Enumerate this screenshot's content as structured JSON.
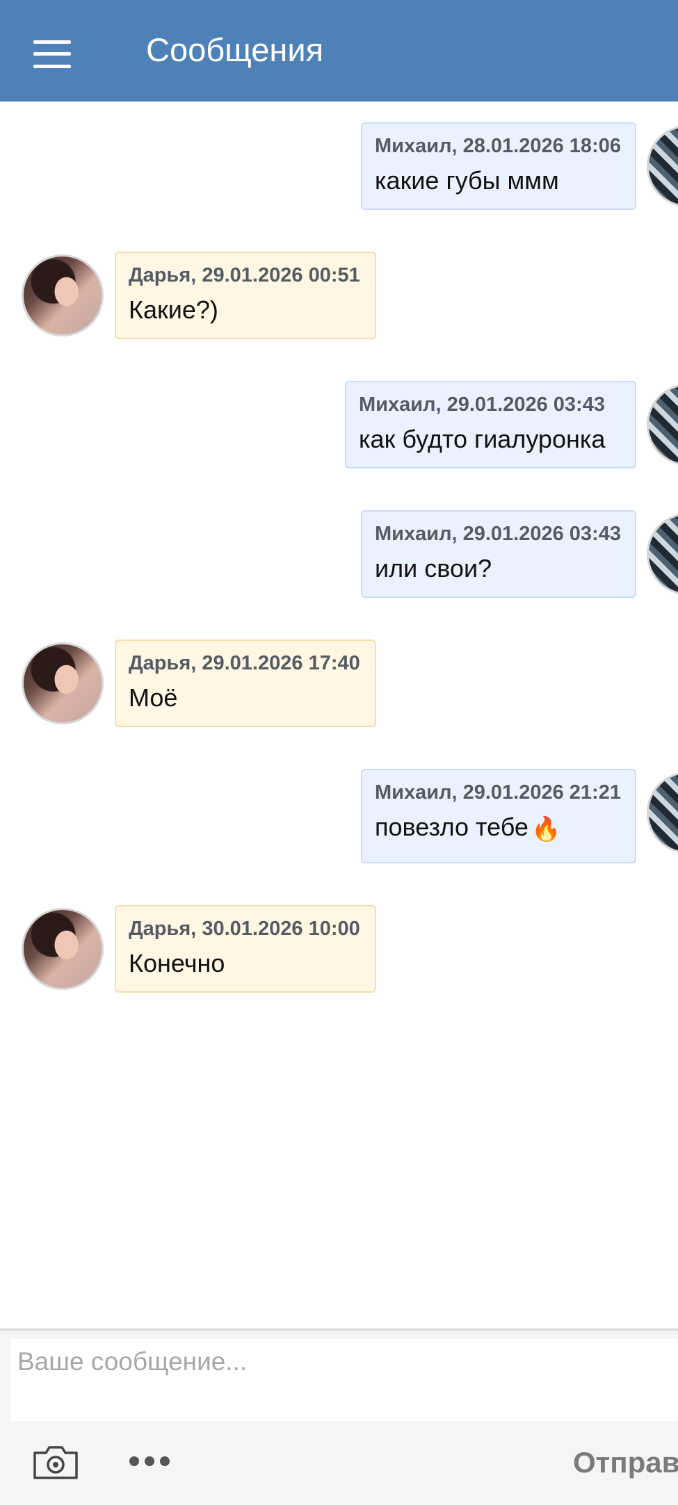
{
  "header": {
    "menu_icon": "hamburger-menu-icon",
    "title": "Сообщения",
    "color": "#4f81b9"
  },
  "messages": [
    {
      "direction": "out",
      "author": "Михаил",
      "datetime": "28.01.2026 18:06",
      "meta": "Михаил, 28.01.2026 18:06",
      "text": "какие губы ммм"
    },
    {
      "direction": "in",
      "author": "Дарья",
      "datetime": "29.01.2026 00:51",
      "meta": "Дарья, 29.01.2026 00:51",
      "text": "Какие?)"
    },
    {
      "direction": "out",
      "author": "Михаил",
      "datetime": "29.01.2026 03:43",
      "meta": "Михаил, 29.01.2026 03:43",
      "text": "как будто гиалуронка"
    },
    {
      "direction": "out",
      "author": "Михаил",
      "datetime": "29.01.2026 03:43",
      "meta": "Михаил, 29.01.2026 03:43",
      "text": "или свои?"
    },
    {
      "direction": "in",
      "author": "Дарья",
      "datetime": "29.01.2026 17:40",
      "meta": "Дарья, 29.01.2026 17:40",
      "text": "Моё"
    },
    {
      "direction": "out",
      "author": "Михаил",
      "datetime": "29.01.2026 21:21",
      "meta": "Михаил, 29.01.2026 21:21",
      "text": "повезло тебе",
      "emoji": "🔥"
    },
    {
      "direction": "in",
      "author": "Дарья",
      "datetime": "30.01.2026 10:00",
      "meta": "Дарья, 30.01.2026 10:00",
      "text": "Конечно"
    }
  ],
  "colors": {
    "outgoing_bubble": "#eaf2ff",
    "incoming_bubble": "#fff6e4"
  },
  "composer": {
    "placeholder": "Ваше сообщение...",
    "value": "",
    "camera_icon": "camera-icon",
    "more_icon": "more-dots-icon",
    "send_label": "Отправ"
  }
}
